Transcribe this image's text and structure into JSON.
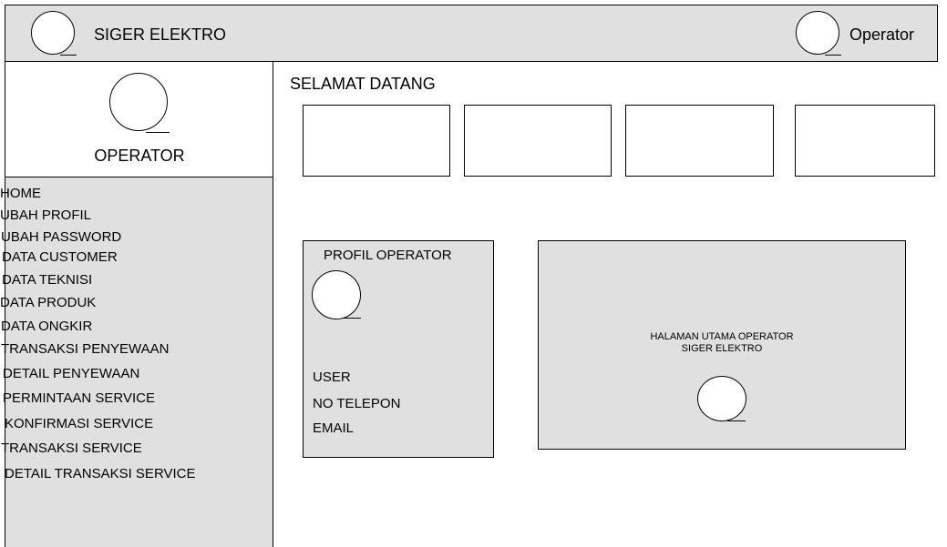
{
  "header": {
    "app_title": "SIGER ELEKTRO",
    "user_label": "Operator",
    "logo_icon": "circle-placeholder-icon",
    "user_icon": "avatar-circle-icon"
  },
  "sidebar": {
    "role_label": "OPERATOR",
    "avatar_icon": "avatar-circle-icon",
    "menu": [
      {
        "label": "HOME"
      },
      {
        "label": "UBAH PROFIL"
      },
      {
        "label": "UBAH PASSWORD"
      },
      {
        "label": "DATA CUSTOMER"
      },
      {
        "label": "DATA TEKNISI"
      },
      {
        "label": "DATA PRODUK"
      },
      {
        "label": "DATA ONGKIR"
      },
      {
        "label": "TRANSAKSI PENYEWAAN"
      },
      {
        "label": "DETAIL PENYEWAAN"
      },
      {
        "label": "PERMINTAAN SERVICE"
      },
      {
        "label": "KONFIRMASI SERVICE"
      },
      {
        "label": "TRANSAKSI SERVICE"
      },
      {
        "label": "DETAIL TRANSAKSI SERVICE"
      }
    ]
  },
  "main": {
    "welcome": "SELAMAT DATANG",
    "profile_panel": {
      "title": "PROFIL OPERATOR",
      "fields": [
        "USER",
        "NO TELEPON",
        "EMAIL"
      ]
    },
    "home_panel": {
      "line1": "HALAMAN UTAMA OPERATOR",
      "line2": "SIGER ELEKTRO"
    }
  },
  "colors": {
    "panel_gray": "#e0e0e0",
    "border": "#000000",
    "background": "#ffffff"
  }
}
